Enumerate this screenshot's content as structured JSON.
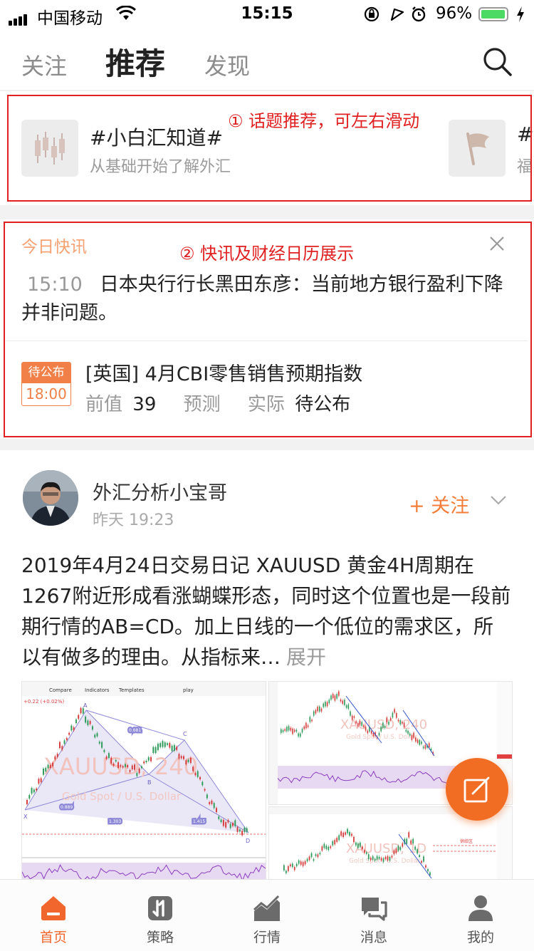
{
  "status_bar": {
    "carrier": "中国移动",
    "time": "15:15",
    "battery": "96%",
    "battery_level": 0.96
  },
  "nav": {
    "tabs": [
      "关注",
      "推荐",
      "发现"
    ],
    "active_tab": "推荐"
  },
  "annotations": {
    "topics_note": "① 话题推荐，可左右滑动",
    "news_note": "② 快讯及财经日历展示"
  },
  "topics": [
    {
      "title": "#小白汇知道#",
      "subtitle": "从基础开始了解外汇",
      "icon": "candlestick-icon"
    },
    {
      "title": "#",
      "subtitle": "福",
      "icon": "flag-icon"
    }
  ],
  "news": {
    "header": "今日快讯",
    "time": "15:10",
    "text": "日本央行行长黑田东彦：当前地方银行盈利下降并非问题。",
    "calendar": {
      "badge_status": "待公布",
      "badge_time": "18:00",
      "title": "[英国] 4月CBI零售销售预期指数",
      "prev_label": "前值",
      "prev_value": "39",
      "forecast_label": "预测",
      "actual_label": "实际",
      "actual_value": "待公布"
    }
  },
  "post": {
    "author": "外汇分析小宝哥",
    "time": "昨天 19:23",
    "follow": "+ 关注",
    "text": "2019年4月24日交易日记 XAUUSD 黄金4H周期在1267附近形成看涨蝴蝶形态，同时这个位置也是一段前期行情的AB=CD。加上日线的一个低位的需求区，所以有做多的理由。从指标来…",
    "expand": "展开",
    "images": [
      {
        "watermark": "XAUUSD, 240",
        "subtitle": "Gold Spot / U.S. Dollar",
        "toolbar": [
          "Compare",
          "Indicators",
          "Templates",
          "play"
        ],
        "price_change": "+0.22 (+0.02%)",
        "pattern_labels": [
          "A",
          "B",
          "C",
          "D",
          "X"
        ],
        "ratios": [
          "0.681",
          "0.889",
          "1.303",
          "1.415"
        ]
      },
      {
        "watermark": "XAUUSD, 240",
        "subtitle": "Gold Spot / U.S. Dollar"
      },
      {
        "watermark": "XAUUSD, 1D",
        "subtitle": "Gold Spot / U.S. Dollar",
        "zone_label": "供给区"
      }
    ]
  },
  "tabbar": [
    {
      "label": "首页",
      "icon": "home-icon",
      "active": true
    },
    {
      "label": "策略",
      "icon": "strategy-icon",
      "active": false
    },
    {
      "label": "行情",
      "icon": "market-chart-icon",
      "active": false
    },
    {
      "label": "消息",
      "icon": "message-icon",
      "active": false
    },
    {
      "label": "我的",
      "icon": "profile-icon",
      "active": false
    }
  ],
  "colors": {
    "accent": "#f0662c",
    "annotation_red": "#e02020",
    "news_header": "#f7a072",
    "battery_green": "#4cd964"
  }
}
